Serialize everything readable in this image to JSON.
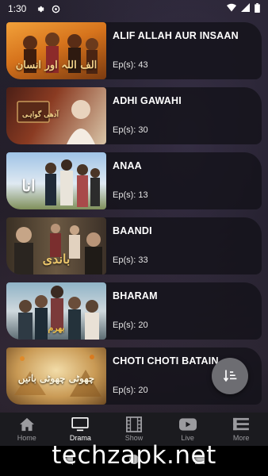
{
  "status_bar": {
    "time": "1:30"
  },
  "dramas": [
    {
      "title": "ALIF ALLAH AUR INSAAN",
      "episodes": "Ep(s): 43",
      "thumb_text": "الف اللہ اور انسان"
    },
    {
      "title": "ADHI GAWAHI",
      "episodes": "Ep(s): 30",
      "thumb_text": "آدھی گواہی"
    },
    {
      "title": "ANAA",
      "episodes": "Ep(s): 13",
      "thumb_text": "انا"
    },
    {
      "title": "BAANDI",
      "episodes": "Ep(s): 33",
      "thumb_text": "باندی"
    },
    {
      "title": "BHARAM",
      "episodes": "Ep(s): 20",
      "thumb_text": "بھرم"
    },
    {
      "title": "CHOTI CHOTI BATAIN",
      "episodes": "Ep(s): 20",
      "thumb_text": "چھوٹی چھوٹی باتیں"
    }
  ],
  "bottom_nav": {
    "items": [
      {
        "label": "Home",
        "icon": "home-icon"
      },
      {
        "label": "Drama",
        "icon": "tv-icon",
        "active": true
      },
      {
        "label": "Show",
        "icon": "film-icon"
      },
      {
        "label": "Live",
        "icon": "youtube-icon"
      },
      {
        "label": "More",
        "icon": "menu-icon"
      }
    ]
  },
  "watermark": "techzapk.net",
  "colors": {
    "accent_active": "#ffffff",
    "nav_inactive": "#9b9b9f",
    "fab": "#6d6d72"
  }
}
